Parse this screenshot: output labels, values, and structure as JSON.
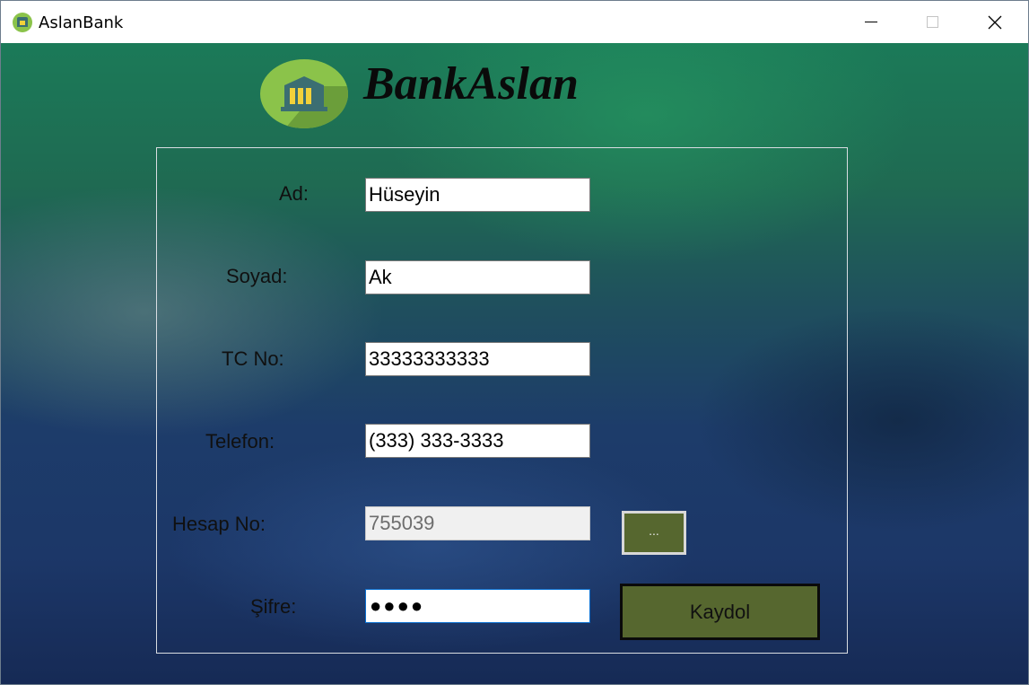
{
  "window": {
    "title": "AslanBank"
  },
  "header": {
    "brand": "BankAslan"
  },
  "form": {
    "ad_label": "Ad:",
    "ad_value": "Hüseyin",
    "soyad_label": "Soyad:",
    "soyad_value": "Ak",
    "tc_label": "TC No:",
    "tc_value": "33333333333",
    "telefon_label": "Telefon:",
    "telefon_value": "(333) 333-3333",
    "hesap_label": "Hesap No:",
    "hesap_value": "755039",
    "sifre_label": "Şifre:",
    "sifre_value": "●●●●",
    "generate_label": "...",
    "register_label": "Kaydol"
  },
  "colors": {
    "button_fill": "#56672f",
    "logo_green": "#8bc34a"
  }
}
